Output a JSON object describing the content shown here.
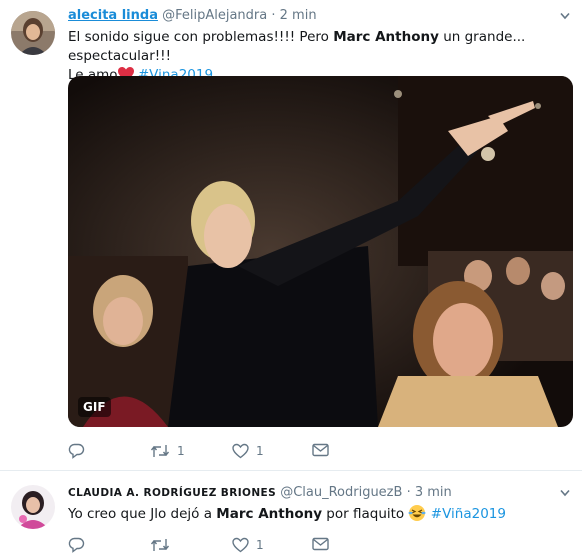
{
  "tweets": [
    {
      "name": "alecita linda",
      "handle": "@FelipAlejandra",
      "separator": "·",
      "time": "2 min",
      "text": {
        "p1": "El sonido sigue con problemas!!!! Pero ",
        "bold": "Marc Anthony",
        "p2": " un grande... espectacular!!!",
        "p3": "Le amo",
        "hashtag": "#Vina2019"
      },
      "media": {
        "badge": "GIF"
      },
      "actions": {
        "reply": "",
        "retweet": "1",
        "like": "1"
      }
    },
    {
      "name": "CLAUDIA A. RODRÍGUEZ BRIONES",
      "handle": "@Clau_RodriguezB",
      "separator": "·",
      "time": "3 min",
      "text": {
        "p1": "Yo creo que Jlo dejó a ",
        "bold": "Marc Anthony",
        "p2": " por flaquito ",
        "hashtag": "#Viña2019"
      },
      "actions": {
        "reply": "",
        "retweet": "",
        "like": "1"
      }
    }
  ],
  "icons": {
    "reply": "reply-icon",
    "retweet": "retweet-icon",
    "like": "heart-icon",
    "dm": "mail-icon",
    "more": "chevron-down-icon"
  },
  "colors": {
    "link": "#1a8cd8",
    "hashtag": "#1b95e0",
    "muted": "#657786",
    "heart": "#e0245e"
  }
}
